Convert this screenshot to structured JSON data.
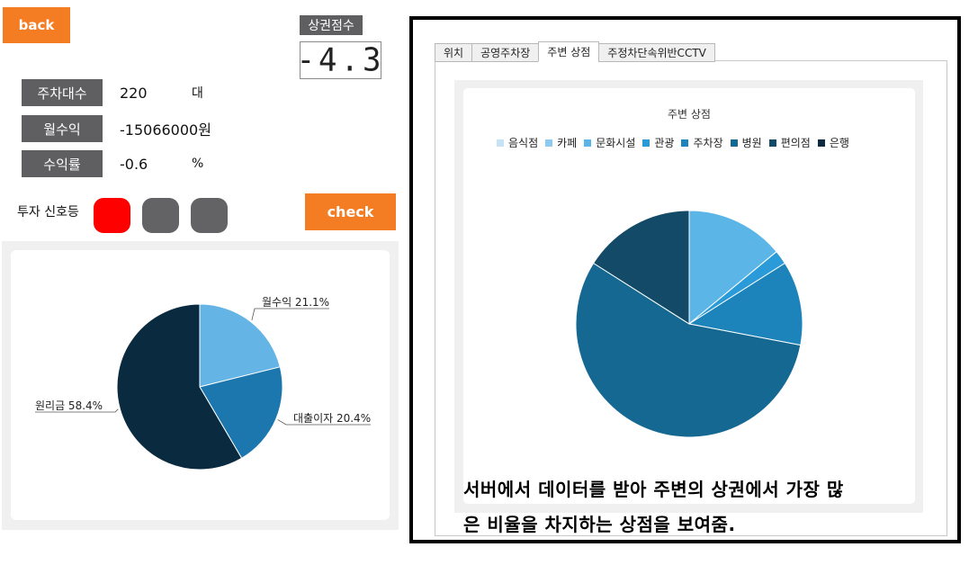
{
  "buttons": {
    "back": "back",
    "check": "check"
  },
  "score": {
    "label": "상권점수",
    "value": "-4.3"
  },
  "metrics": [
    {
      "label": "주차대수",
      "value": "220",
      "unit": "대"
    },
    {
      "label": "월수익",
      "value": "-15066000원",
      "unit": ""
    },
    {
      "label": "수익률",
      "value": "-0.6",
      "unit": "%"
    }
  ],
  "signal": {
    "label": "투자 신호등",
    "lights": [
      "#ff0000",
      "#636366",
      "#636366"
    ]
  },
  "tabs": [
    {
      "label": "위치",
      "active": false
    },
    {
      "label": "공영주차장",
      "active": false
    },
    {
      "label": "주변 상점",
      "active": true
    },
    {
      "label": "주정차단속위반CCTV",
      "active": false
    }
  ],
  "caption": {
    "line1": "서버에서 데이터를 받아 주변의 상권에서 가장 많",
    "line2": "은 비율을 차지하는 상점을 보여줌."
  },
  "chart_data": [
    {
      "type": "pie",
      "title": "",
      "slices": [
        {
          "label": "월수익",
          "value": 21.1,
          "text": "월수익 21.1%",
          "color": "#64b5e6"
        },
        {
          "label": "대출이자",
          "value": 20.4,
          "text": "대출이자 20.4%",
          "color": "#1b77ad"
        },
        {
          "label": "원리금",
          "value": 58.4,
          "text": "원리금 58.4%",
          "color": "#0a2a40"
        }
      ]
    },
    {
      "type": "pie",
      "title": "주변 상점",
      "legend_position": "top",
      "slices": [
        {
          "label": "음식점",
          "value": 0,
          "color": "#c6e2f5"
        },
        {
          "label": "카페",
          "value": 0,
          "color": "#8ec9ee"
        },
        {
          "label": "문화시설",
          "value": 14,
          "color": "#5bb5e6"
        },
        {
          "label": "관광",
          "value": 2,
          "color": "#2b9ad9"
        },
        {
          "label": "주차장",
          "value": 12,
          "color": "#1c84bb"
        },
        {
          "label": "병원",
          "value": 56,
          "color": "#156891"
        },
        {
          "label": "편의점",
          "value": 16,
          "color": "#124a68"
        },
        {
          "label": "은행",
          "value": 0,
          "color": "#0c2940"
        }
      ]
    }
  ]
}
